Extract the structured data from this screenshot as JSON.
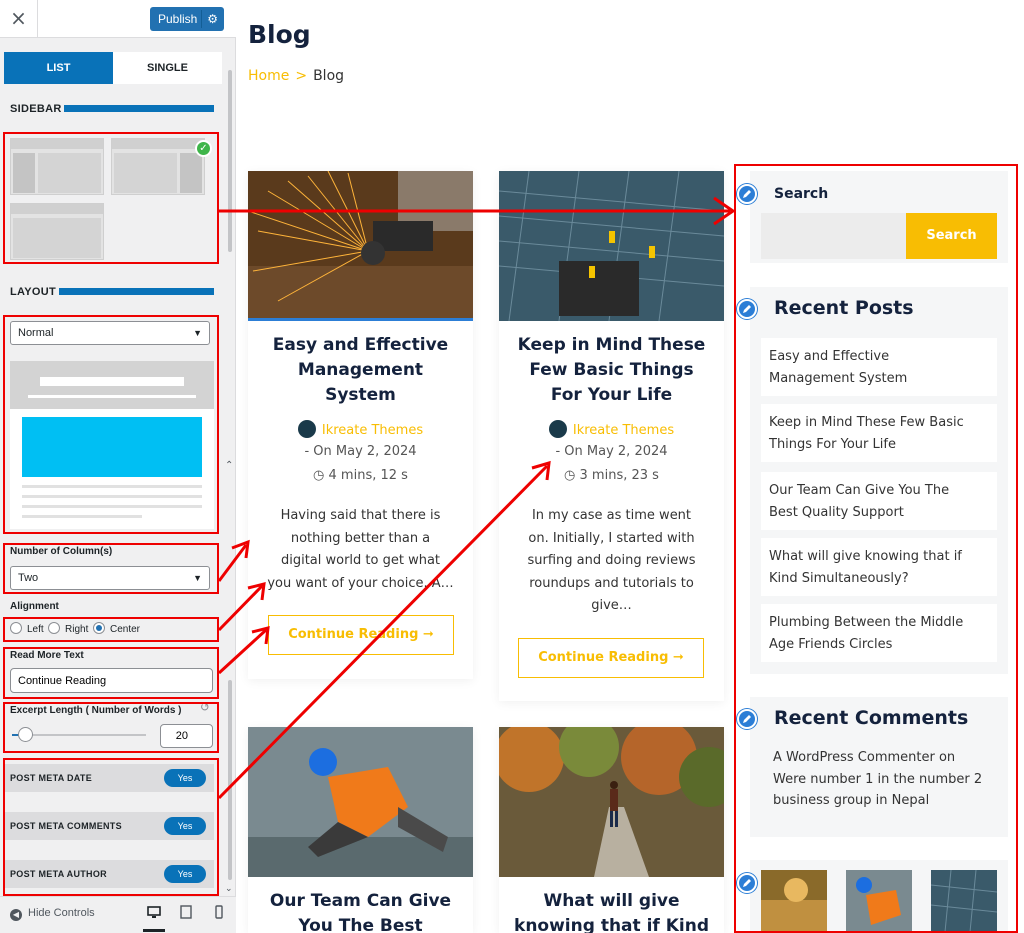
{
  "customizer": {
    "close_symbol": "×",
    "publish_label": "Publish",
    "tabs": [
      {
        "label": "LIST"
      },
      {
        "label": "SINGLE"
      }
    ],
    "sidebar_heading": "SIDEBAR",
    "layout_heading": "LAYOUT",
    "layout_select_value": "Normal",
    "columns_label": "Number of Column(s)",
    "columns_value": "Two",
    "alignment_label": "Alignment",
    "alignment_options": [
      {
        "label": "Left",
        "selected": false
      },
      {
        "label": "Right",
        "selected": false
      },
      {
        "label": "Center",
        "selected": true
      }
    ],
    "read_more_label": "Read More Text",
    "read_more_value": "Continue Reading",
    "excerpt_label": "Excerpt Length ( Number of Words )",
    "excerpt_value": "20",
    "excerpt_slider_fraction": 0.05,
    "meta_toggles": [
      {
        "label": "POST META DATE",
        "value": "Yes"
      },
      {
        "label": "POST META COMMENTS",
        "value": "Yes"
      },
      {
        "label": "POST META AUTHOR",
        "value": "Yes"
      }
    ],
    "hide_controls_label": "Hide Controls"
  },
  "preview": {
    "page_title": "Blog",
    "breadcrumb": {
      "home": "Home",
      "separator": ">",
      "current": "Blog"
    },
    "posts": [
      {
        "title_lines": [
          "Easy and Effective",
          "Management",
          "System"
        ],
        "author": "Ikreate Themes",
        "date": "- On May 2, 2024",
        "read_time": "4 mins, 12 s",
        "excerpt_lines": [
          "Having said that there is",
          "nothing better than a",
          "digital world to get what",
          "you want of your choice. A…"
        ],
        "button": "Continue Reading ➞"
      },
      {
        "title_lines": [
          "Keep in Mind These",
          "Few Basic Things",
          "For Your Life"
        ],
        "author": "Ikreate Themes",
        "date": "- On May 2, 2024",
        "read_time": "3 mins, 23 s",
        "excerpt_lines": [
          "In my case as time went",
          "on. Initially, I started with",
          "surfing and doing reviews",
          "roundups and tutorials to",
          "give…"
        ],
        "button": "Continue Reading ➞"
      },
      {
        "title_lines": [
          "Our Team Can Give",
          "You The Best"
        ]
      },
      {
        "title_lines": [
          "What will give",
          "knowing that if Kind"
        ]
      }
    ],
    "sidebar": {
      "search_title": "Search",
      "search_button": "Search",
      "recent_posts_title": "Recent Posts",
      "recent_posts": [
        {
          "lines": [
            "Easy and Effective",
            "Management System"
          ]
        },
        {
          "lines": [
            "Keep in Mind These Few Basic",
            "Things For Your Life"
          ]
        },
        {
          "lines": [
            "Our Team Can Give You The",
            "Best Quality Support"
          ]
        },
        {
          "lines": [
            "What will give knowing that if",
            "Kind Simultaneously?"
          ]
        },
        {
          "lines": [
            "Plumbing Between the Middle",
            "Age Friends Circles"
          ]
        }
      ],
      "recent_comments_title": "Recent Comments",
      "recent_comment_lines": [
        "A WordPress Commenter on",
        "Were number 1 in the number 2",
        "business group in Nepal"
      ]
    }
  },
  "colors": {
    "accent_blue": "#0972b8",
    "accent_yellow": "#f8bd03",
    "annotation_red": "#e00000"
  }
}
